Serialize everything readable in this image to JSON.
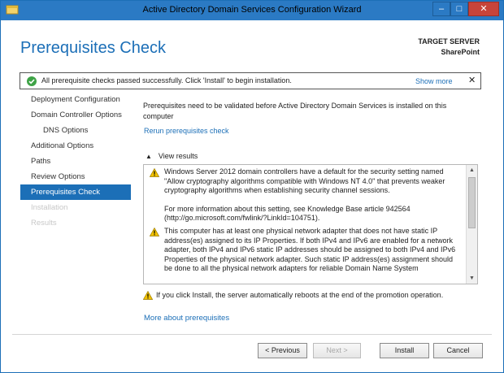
{
  "window": {
    "title": "Active Directory Domain Services Configuration Wizard",
    "minimize": "–",
    "maximize": "□",
    "close": "✕"
  },
  "header": {
    "page_title": "Prerequisites Check",
    "target_label": "TARGET SERVER",
    "target_value": "SharePoint"
  },
  "alert": {
    "message": "All prerequisite checks passed successfully.  Click 'Install' to begin installation.",
    "show_more": "Show more",
    "close": "✕",
    "icon": "check-circle-icon",
    "icon_color": "#3ea346"
  },
  "sidebar": {
    "items": [
      {
        "label": "Deployment Configuration",
        "state": "normal"
      },
      {
        "label": "Domain Controller Options",
        "state": "normal"
      },
      {
        "label": "DNS Options",
        "state": "sub"
      },
      {
        "label": "Additional Options",
        "state": "normal"
      },
      {
        "label": "Paths",
        "state": "normal"
      },
      {
        "label": "Review Options",
        "state": "normal"
      },
      {
        "label": "Prerequisites Check",
        "state": "active"
      },
      {
        "label": "Installation",
        "state": "disabled"
      },
      {
        "label": "Results",
        "state": "disabled"
      }
    ]
  },
  "main": {
    "intro": "Prerequisites need to be validated before Active Directory Domain Services is installed on this computer",
    "rerun": "Rerun prerequisites check",
    "view_results": "View results",
    "results": [
      {
        "paragraphs": [
          "Windows Server 2012 domain controllers have a default for the security setting named \"Allow cryptography algorithms compatible with Windows NT 4.0\" that prevents weaker cryptography algorithms when establishing security channel sessions.",
          "For more information about this setting, see Knowledge Base article 942564 (http://go.microsoft.com/fwlink/?LinkId=104751)."
        ]
      },
      {
        "paragraphs": [
          "This computer has at least one physical network adapter that does not have static IP address(es) assigned to its IP Properties. If both IPv4 and IPv6 are enabled for a network adapter, both IPv4 and IPv6 static IP addresses should be assigned to both IPv4 and IPv6 Properties of the physical network adapter. Such static IP address(es) assignment should be done to all the physical network adapters for reliable Domain Name System"
        ]
      }
    ],
    "reboot_warning": "If you click Install, the server automatically reboots at the end of the promotion operation.",
    "more_link": "More about prerequisites",
    "accent_color": "#1c6fb7",
    "warning_color": "#f2c200"
  },
  "footer": {
    "previous": "< Previous",
    "next": "Next >",
    "install": "Install",
    "cancel": "Cancel"
  }
}
